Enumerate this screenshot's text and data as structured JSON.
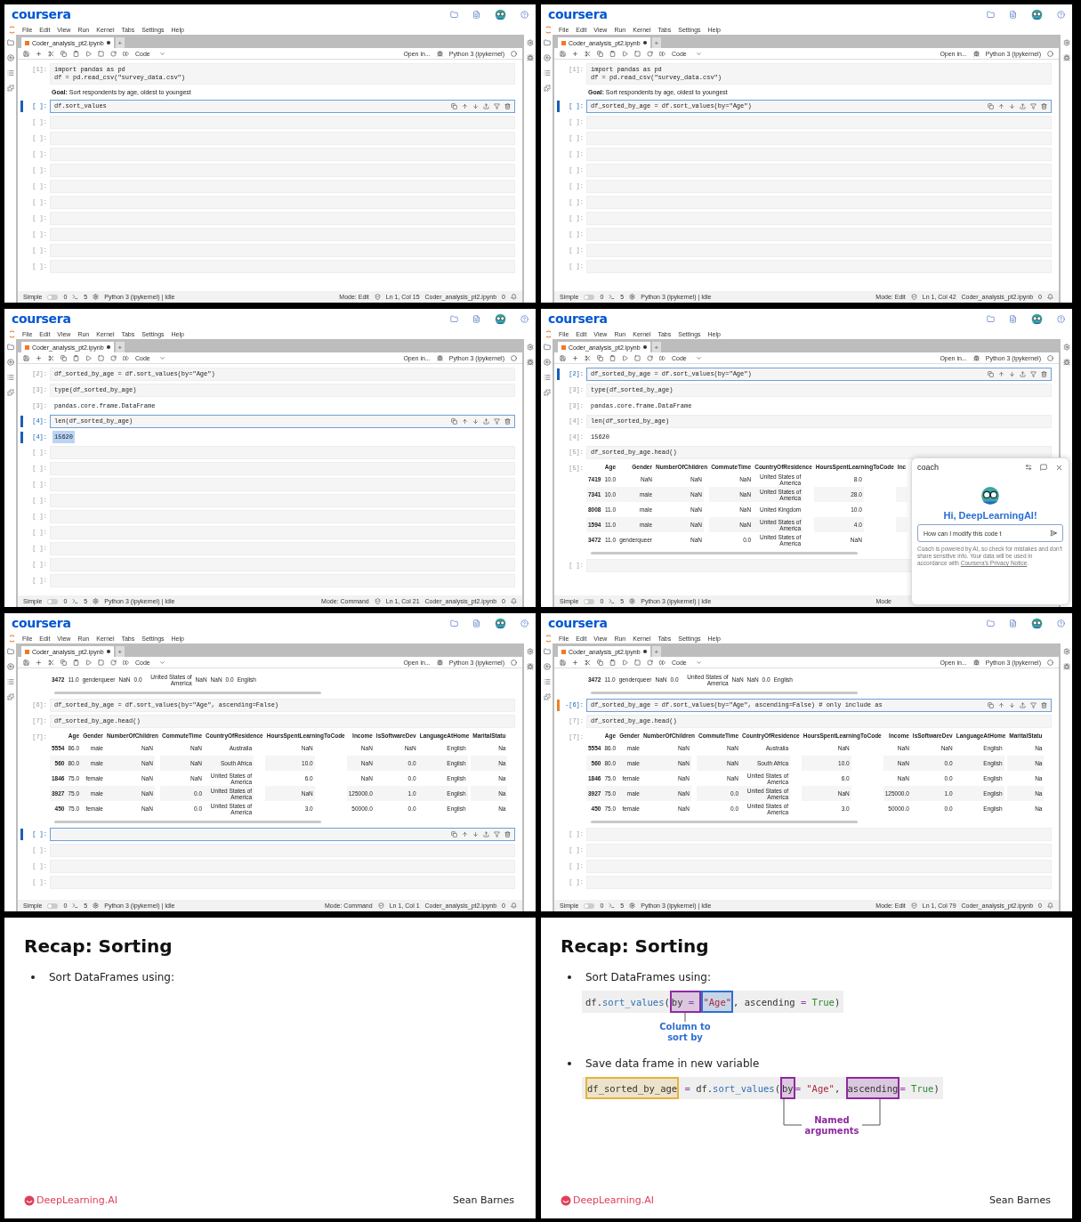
{
  "frames": [
    {
      "kind": "notebook",
      "logo": "coursera",
      "menu": [
        "File",
        "Edit",
        "View",
        "Run",
        "Kernel",
        "Tabs",
        "Settings",
        "Help"
      ],
      "tab": "Coder_analysis_pt2.ipynb",
      "tab_add": "+",
      "cell_type": "Code",
      "open_in": "Open in...",
      "kernel": "Python 3 (ipykernel)",
      "cells": [
        {
          "kind": "code",
          "prompt": "[1]:",
          "code": "import pandas as pd\ndf = pd.read_csv(\"survey_data.csv\")",
          "active": false,
          "edited": false
        },
        {
          "kind": "markdown",
          "text": "**Goal:** Sort respondents by age, oldest to youngest"
        },
        {
          "kind": "code",
          "prompt": "[ ]:",
          "code": "df.sort_values",
          "active": true,
          "edited": false
        },
        {
          "kind": "code",
          "prompt": "[ ]:",
          "active": false,
          "edited": false
        },
        {
          "kind": "code",
          "prompt": "[ ]:",
          "active": false,
          "edited": false
        },
        {
          "kind": "code",
          "prompt": "[ ]:",
          "active": false,
          "edited": false
        },
        {
          "kind": "code",
          "prompt": "[ ]:",
          "active": false,
          "edited": false
        },
        {
          "kind": "code",
          "prompt": "[ ]:",
          "active": false,
          "edited": false
        },
        {
          "kind": "code",
          "prompt": "[ ]:",
          "active": false,
          "edited": false
        },
        {
          "kind": "code",
          "prompt": "[ ]:",
          "active": false,
          "edited": false
        },
        {
          "kind": "code",
          "prompt": "[ ]:",
          "active": false,
          "edited": false
        },
        {
          "kind": "code",
          "prompt": "[ ]:",
          "active": false,
          "edited": false
        },
        {
          "kind": "code",
          "prompt": "[ ]:",
          "active": false,
          "edited": false
        }
      ],
      "status": {
        "toggle_label": "Simple",
        "simple_on": false,
        "counts": [
          "0",
          "5"
        ],
        "kernel_status": "Python 3 (ipykernel) | Idle",
        "mode": "Mode: Edit",
        "cursor": "Ln 1, Col 15",
        "file": "Coder_analysis_pt2.ipynb",
        "notifications": "0"
      }
    },
    {
      "kind": "notebook",
      "logo": "coursera",
      "menu": [
        "File",
        "Edit",
        "View",
        "Run",
        "Kernel",
        "Tabs",
        "Settings",
        "Help"
      ],
      "tab": "Coder_analysis_pt2.ipynb",
      "tab_add": "+",
      "cell_type": "Code",
      "open_in": "Open in...",
      "kernel": "Python 3 (ipykernel)",
      "cells": [
        {
          "kind": "code",
          "prompt": "[1]:",
          "code": "import pandas as pd\ndf = pd.read_csv(\"survey_data.csv\")",
          "active": false,
          "edited": false
        },
        {
          "kind": "markdown",
          "text": "**Goal:** Sort respondents by age, oldest to youngest"
        },
        {
          "kind": "code",
          "prompt": "[ ]:",
          "code": "df_sorted_by_age = df.sort_values(by=\"Age\")",
          "active": true,
          "edited": false
        },
        {
          "kind": "code",
          "prompt": "[ ]:",
          "active": false,
          "edited": false
        },
        {
          "kind": "code",
          "prompt": "[ ]:",
          "active": false,
          "edited": false
        },
        {
          "kind": "code",
          "prompt": "[ ]:",
          "active": false,
          "edited": false
        },
        {
          "kind": "code",
          "prompt": "[ ]:",
          "active": false,
          "edited": false
        },
        {
          "kind": "code",
          "prompt": "[ ]:",
          "active": false,
          "edited": false
        },
        {
          "kind": "code",
          "prompt": "[ ]:",
          "active": false,
          "edited": false
        },
        {
          "kind": "code",
          "prompt": "[ ]:",
          "active": false,
          "edited": false
        },
        {
          "kind": "code",
          "prompt": "[ ]:",
          "active": false,
          "edited": false
        },
        {
          "kind": "code",
          "prompt": "[ ]:",
          "active": false,
          "edited": false
        },
        {
          "kind": "code",
          "prompt": "[ ]:",
          "active": false,
          "edited": false
        }
      ],
      "status": {
        "toggle_label": "Simple",
        "simple_on": false,
        "counts": [
          "0",
          "5"
        ],
        "kernel_status": "Python 3 (ipykernel) | Idle",
        "mode": "Mode: Edit",
        "cursor": "Ln 1, Col 42",
        "file": "Coder_analysis_pt2.ipynb",
        "notifications": "0"
      }
    },
    {
      "kind": "notebook",
      "logo": "coursera",
      "menu": [
        "File",
        "Edit",
        "View",
        "Run",
        "Kernel",
        "Tabs",
        "Settings",
        "Help"
      ],
      "tab": "Coder_analysis_pt2.ipynb",
      "tab_add": "+",
      "cell_type": "Code",
      "open_in": "Open in...",
      "kernel": "Python 3 (ipykernel)",
      "cells": [
        {
          "kind": "code",
          "prompt": "[2]:",
          "code": "df_sorted_by_age = df.sort_values(by=\"Age\")",
          "active": false,
          "edited": false
        },
        {
          "kind": "code",
          "prompt": "[3]:",
          "code": "type(df_sorted_by_age)",
          "active": false,
          "edited": false
        },
        {
          "kind": "output",
          "prompt": "[3]:",
          "text": "pandas.core.frame.DataFrame",
          "active": false,
          "highlighted": false
        },
        {
          "kind": "code",
          "prompt": "[4]:",
          "code": "len(df_sorted_by_age)",
          "active": true,
          "edited": false
        },
        {
          "kind": "output",
          "prompt": "[4]:",
          "text": "15620",
          "active": true,
          "highlighted": true
        },
        {
          "kind": "code",
          "prompt": "[ ]:",
          "active": false,
          "edited": false
        },
        {
          "kind": "code",
          "prompt": "[ ]:",
          "active": false,
          "edited": false
        },
        {
          "kind": "code",
          "prompt": "[ ]:",
          "active": false,
          "edited": false
        },
        {
          "kind": "code",
          "prompt": "[ ]:",
          "active": false,
          "edited": false
        },
        {
          "kind": "code",
          "prompt": "[ ]:",
          "active": false,
          "edited": false
        },
        {
          "kind": "code",
          "prompt": "[ ]:",
          "active": false,
          "edited": false
        },
        {
          "kind": "code",
          "prompt": "[ ]:",
          "active": false,
          "edited": false
        },
        {
          "kind": "code",
          "prompt": "[ ]:",
          "active": false,
          "edited": false
        },
        {
          "kind": "code",
          "prompt": "[ ]:",
          "active": false,
          "edited": false
        }
      ],
      "status": {
        "toggle_label": "Simple",
        "simple_on": false,
        "counts": [
          "0",
          "5"
        ],
        "kernel_status": "Python 3 (ipykernel) | Idle",
        "mode": "Mode: Command",
        "cursor": "Ln 1, Col 21",
        "file": "Coder_analysis_pt2.ipynb",
        "notifications": "0"
      }
    },
    {
      "kind": "notebook",
      "logo": "coursera",
      "menu": [
        "File",
        "Edit",
        "View",
        "Run",
        "Kernel",
        "Tabs",
        "Settings",
        "Help"
      ],
      "tab": "Coder_analysis_pt2.ipynb",
      "tab_add": "+",
      "cell_type": "Code",
      "open_in": "Open in...",
      "kernel": "Python 3 (ipykernel)",
      "cells": [
        {
          "kind": "code",
          "prompt": "[2]:",
          "code": "df_sorted_by_age = df.sort_values(by=\"Age\")",
          "active": true,
          "edited": false
        },
        {
          "kind": "code",
          "prompt": "[3]:",
          "code": "type(df_sorted_by_age)",
          "active": false,
          "edited": false
        },
        {
          "kind": "output",
          "prompt": "[3]:",
          "text": "pandas.core.frame.DataFrame",
          "active": false,
          "highlighted": false
        },
        {
          "kind": "code",
          "prompt": "[4]:",
          "code": "len(df_sorted_by_age)",
          "active": false,
          "edited": false
        },
        {
          "kind": "output",
          "prompt": "[4]:",
          "text": "15620",
          "active": false,
          "highlighted": false
        },
        {
          "kind": "code",
          "prompt": "[5]:",
          "code": "df_sorted_by_age.head()",
          "active": false,
          "edited": false
        },
        {
          "kind": "table",
          "prompt": "[5]:",
          "columns": [
            "",
            "Age",
            "Gender",
            "NumberOfChildren",
            "CommuteTime",
            "CountryOfResidence",
            "HoursSpentLearningToCode",
            "Inc"
          ],
          "rows": [
            [
              "7419",
              "10.0",
              "NaN",
              "NaN",
              "NaN",
              "United States of America",
              "8.0"
            ],
            [
              "7341",
              "10.0",
              "male",
              "NaN",
              "NaN",
              "United States of America",
              "28.0"
            ],
            [
              "8008",
              "11.0",
              "male",
              "NaN",
              "NaN",
              "United Kingdom",
              "10.0"
            ],
            [
              "1594",
              "11.0",
              "male",
              "NaN",
              "NaN",
              "United States of America",
              "4.0"
            ],
            [
              "3472",
              "11.0",
              "genderqueer",
              "NaN",
              "0.0",
              "United States of America",
              "NaN"
            ]
          ]
        },
        {
          "kind": "scrollbar"
        },
        {
          "kind": "code",
          "prompt": "[ ]:",
          "active": false,
          "edited": false
        }
      ],
      "status": {
        "toggle_label": "Simple",
        "simple_on": false,
        "counts": [
          "0",
          "5"
        ],
        "kernel_status": "Python 3 (ipykernel) | Idle",
        "mode": "Mode"
      },
      "coach": {
        "title": "coach",
        "greeting": "Hi, DeepLearningAI!",
        "input": "How can I modify this code t",
        "disclaimer": "Coach is powered by AI, so check for mistakes and don't share sensitive info. Your data will be used in accordance with ",
        "link": "Coursera's Privacy Notice",
        "after_link": "."
      }
    },
    {
      "kind": "notebook",
      "logo": "coursera",
      "menu": [
        "File",
        "Edit",
        "View",
        "Run",
        "Kernel",
        "Tabs",
        "Settings",
        "Help"
      ],
      "tab": "Coder_analysis_pt2.ipynb",
      "tab_add": "+",
      "cell_type": "Code",
      "open_in": "Open in...",
      "kernel": "Python 3 (ipykernel)",
      "cells": [
        {
          "kind": "table",
          "rows": [
            [
              "3472",
              "11.0",
              "genderqueer",
              "NaN",
              "0.0",
              "United States of America",
              "NaN",
              "NaN",
              "0.0",
              "English"
            ]
          ]
        },
        {
          "kind": "scrollbar"
        },
        {
          "kind": "code",
          "prompt": "[6]:",
          "code": "df_sorted_by_age = df.sort_values(by=\"Age\", ascending=False)",
          "active": false,
          "edited": false
        },
        {
          "kind": "code",
          "prompt": "[7]:",
          "code": "df_sorted_by_age.head()",
          "active": false,
          "edited": false
        },
        {
          "kind": "table",
          "prompt": "[7]:",
          "columns": [
            "",
            "Age",
            "Gender",
            "NumberOfChildren",
            "CommuteTime",
            "CountryOfResidence",
            "HoursSpentLearningToCode",
            "Income",
            "IsSoftwareDev",
            "LanguageAtHome",
            "MaritalStatu"
          ],
          "rows": [
            [
              "5554",
              "86.0",
              "male",
              "NaN",
              "NaN",
              "Australia",
              "NaN",
              "NaN",
              "NaN",
              "English",
              "Na"
            ],
            [
              "560",
              "80.0",
              "male",
              "NaN",
              "NaN",
              "South Africa",
              "10.0",
              "NaN",
              "0.0",
              "English",
              "Na"
            ],
            [
              "1846",
              "75.0",
              "female",
              "NaN",
              "NaN",
              "United States of America",
              "6.0",
              "NaN",
              "0.0",
              "English",
              "Na"
            ],
            [
              "3927",
              "75.0",
              "male",
              "NaN",
              "0.0",
              "United States of America",
              "NaN",
              "125000.0",
              "1.0",
              "English",
              "Na"
            ],
            [
              "450",
              "75.0",
              "female",
              "NaN",
              "0.0",
              "United States of America",
              "3.0",
              "50000.0",
              "0.0",
              "English",
              "Na"
            ]
          ]
        },
        {
          "kind": "scrollbar"
        },
        {
          "kind": "code",
          "prompt": "[ ]:",
          "active": true,
          "edited": false
        },
        {
          "kind": "code",
          "prompt": "[ ]:",
          "active": false,
          "edited": false
        },
        {
          "kind": "code",
          "prompt": "[ ]:",
          "active": false,
          "edited": false
        },
        {
          "kind": "code",
          "prompt": "[ ]:",
          "active": false,
          "edited": false
        }
      ],
      "status": {
        "toggle_label": "Simple",
        "simple_on": false,
        "counts": [
          "0",
          "5"
        ],
        "kernel_status": "Python 3 (ipykernel) | Idle",
        "mode": "Mode: Command",
        "cursor": "Ln 1, Col 1",
        "file": "Coder_analysis_pt2.ipynb",
        "notifications": "0"
      }
    },
    {
      "kind": "notebook",
      "logo": "coursera",
      "menu": [
        "File",
        "Edit",
        "View",
        "Run",
        "Kernel",
        "Tabs",
        "Settings",
        "Help"
      ],
      "tab": "Coder_analysis_pt2.ipynb",
      "tab_add": "+",
      "cell_type": "Code",
      "open_in": "Open in...",
      "kernel": "Python 3 (ipykernel)",
      "cells": [
        {
          "kind": "table",
          "rows": [
            [
              "3472",
              "11.0",
              "genderqueer",
              "NaN",
              "0.0",
              "United States of America",
              "NaN",
              "NaN",
              "0.0",
              "English"
            ]
          ]
        },
        {
          "kind": "scrollbar"
        },
        {
          "kind": "code",
          "prompt": "-[6]:",
          "code": "df_sorted_by_age = df.sort_values(by=\"Age\", ascending=False) # only include as",
          "active": true,
          "edited": true
        },
        {
          "kind": "code",
          "prompt": "[7]:",
          "code": "df_sorted_by_age.head()",
          "active": false,
          "edited": false
        },
        {
          "kind": "table",
          "prompt": "[7]:",
          "columns": [
            "",
            "Age",
            "Gender",
            "NumberOfChildren",
            "CommuteTime",
            "CountryOfResidence",
            "HoursSpentLearningToCode",
            "Income",
            "IsSoftwareDev",
            "LanguageAtHome",
            "MaritalStatu"
          ],
          "rows": [
            [
              "5554",
              "86.0",
              "male",
              "NaN",
              "NaN",
              "Australia",
              "NaN",
              "NaN",
              "NaN",
              "English",
              "Na"
            ],
            [
              "560",
              "80.0",
              "male",
              "NaN",
              "NaN",
              "South Africa",
              "10.0",
              "NaN",
              "0.0",
              "English",
              "Na"
            ],
            [
              "1846",
              "75.0",
              "female",
              "NaN",
              "NaN",
              "United States of America",
              "6.0",
              "NaN",
              "0.0",
              "English",
              "Na"
            ],
            [
              "3927",
              "75.0",
              "male",
              "NaN",
              "0.0",
              "United States of America",
              "NaN",
              "125000.0",
              "1.0",
              "English",
              "Na"
            ],
            [
              "450",
              "75.0",
              "female",
              "NaN",
              "0.0",
              "United States of America",
              "3.0",
              "50000.0",
              "0.0",
              "English",
              "Na"
            ]
          ]
        },
        {
          "kind": "scrollbar"
        },
        {
          "kind": "code",
          "prompt": "[ ]:",
          "active": false,
          "edited": false
        },
        {
          "kind": "code",
          "prompt": "[ ]:",
          "active": false,
          "edited": false
        },
        {
          "kind": "code",
          "prompt": "[ ]:",
          "active": false,
          "edited": false
        },
        {
          "kind": "code",
          "prompt": "[ ]:",
          "active": false,
          "edited": false
        }
      ],
      "status": {
        "toggle_label": "Simple",
        "simple_on": false,
        "counts": [
          "0",
          "5"
        ],
        "kernel_status": "Python 3 (ipykernel) | Idle",
        "mode": "Mode: Edit",
        "cursor": "Ln 1, Col 79",
        "file": "Coder_analysis_pt2.ipynb",
        "notifications": "0"
      }
    },
    {
      "kind": "slide",
      "title": "Recap: Sorting",
      "bullets": [
        {
          "text": "Sort DataFrames using:"
        }
      ],
      "logo": "DeepLearning.AI",
      "presenter": "Sean Barnes"
    },
    {
      "kind": "slide",
      "title": "Recap: Sorting",
      "bullets": [
        {
          "text": "Sort DataFrames using:",
          "code": [
            {
              "kind": "plain",
              "text": "df."
            },
            {
              "kind": "method",
              "text": "sort_values"
            },
            {
              "kind": "plain",
              "text": "("
            },
            {
              "kind": "highlight",
              "color": "#8e2a9e",
              "parts": [
                {
                  "kind": "plain",
                  "text": "by "
                },
                {
                  "kind": "operator",
                  "text": "= "
                }
              ]
            },
            {
              "kind": "highlight",
              "color": "#2f6fcf",
              "parts": [
                {
                  "kind": "string",
                  "text": "\"Age\""
                }
              ]
            },
            {
              "kind": "plain",
              "text": ", ascending "
            },
            {
              "kind": "operator",
              "text": "="
            },
            {
              "kind": "keyword",
              "text": " True"
            },
            {
              "kind": "plain",
              "text": ")"
            }
          ],
          "note": {
            "kind": "column",
            "text": "Column to sort by"
          }
        },
        {
          "text": "Save data frame in new variable",
          "code": [
            {
              "kind": "highlight",
              "color": "#e6b33a",
              "parts": [
                {
                  "kind": "plain",
                  "text": "df_sorted_by_age"
                }
              ]
            },
            {
              "kind": "operator",
              "text": " = "
            },
            {
              "kind": "plain",
              "text": "df."
            },
            {
              "kind": "method",
              "text": "sort_values"
            },
            {
              "kind": "plain",
              "text": "("
            },
            {
              "kind": "highlight",
              "color": "#8e2a9e",
              "parts": [
                {
                  "kind": "plain",
                  "text": "by"
                }
              ]
            },
            {
              "kind": "operator",
              "text": "= "
            },
            {
              "kind": "string",
              "text": "\"Age\""
            },
            {
              "kind": "plain",
              "text": ", "
            },
            {
              "kind": "highlight",
              "color": "#8e2a9e",
              "parts": [
                {
                  "kind": "plain",
                  "text": "ascending"
                }
              ]
            },
            {
              "kind": "operator",
              "text": "= "
            },
            {
              "kind": "keyword",
              "text": "True"
            },
            {
              "kind": "plain",
              "text": ")"
            }
          ],
          "note": {
            "kind": "named",
            "text": "Named arguments"
          }
        }
      ],
      "logo": "DeepLearning.AI",
      "presenter": "Sean Barnes"
    }
  ]
}
